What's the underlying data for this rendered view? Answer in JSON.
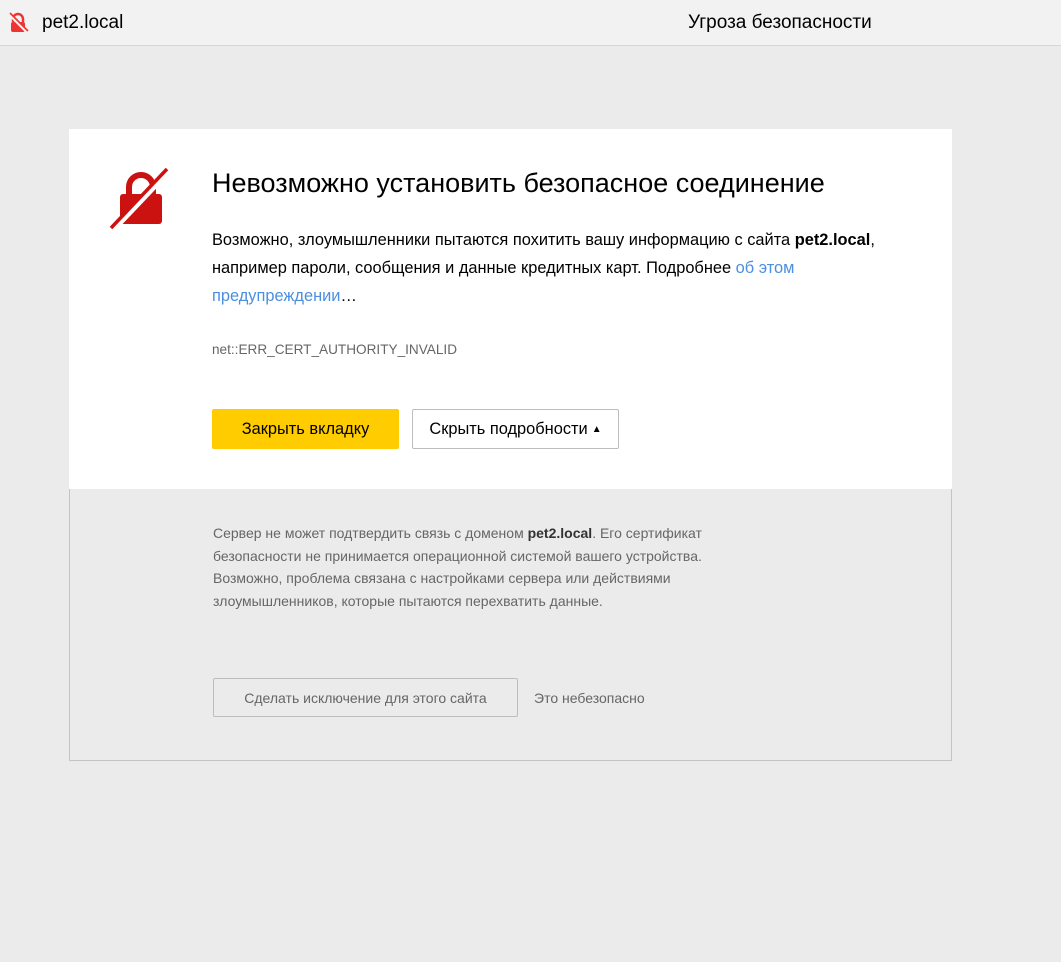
{
  "topbar": {
    "lock_icon": "broken-lock-icon",
    "domain": "pet2.local",
    "title": "Угроза безопасности"
  },
  "card": {
    "icon": "crossed-lock-icon",
    "heading": "Невозможно установить безопасное соединение",
    "desc_before": "Возможно, злоумышленники пытаются похитить вашу информацию с сайта ",
    "desc_domain": "pet2.local",
    "desc_after": ", например пароли, сообщения и данные кредитных карт. Подробнее ",
    "desc_link": "об этом предупреждении",
    "desc_ellipsis": "…",
    "error_code": "net::ERR_CERT_AUTHORITY_INVALID",
    "close_button": "Закрыть вкладку",
    "details_button": "Скрыть подробности",
    "details_arrow": "▲"
  },
  "details": {
    "text_before": "Сервер не может подтвердить связь с доменом ",
    "text_domain": "pet2.local",
    "text_after": ". Его сертификат безопасности не принимается операционной системой вашего устройства. Возможно, проблема связана с настройками сервера или действиями злоумышленников, которые пытаются перехватить данные.",
    "exception_button": "Сделать исключение для этого сайта",
    "unsafe_note": "Это небезопасно"
  },
  "colors": {
    "accent_yellow": "#ffcc00",
    "warning_red": "#cc1111",
    "link_blue": "#4a8fe0",
    "page_background": "#ebebeb"
  }
}
